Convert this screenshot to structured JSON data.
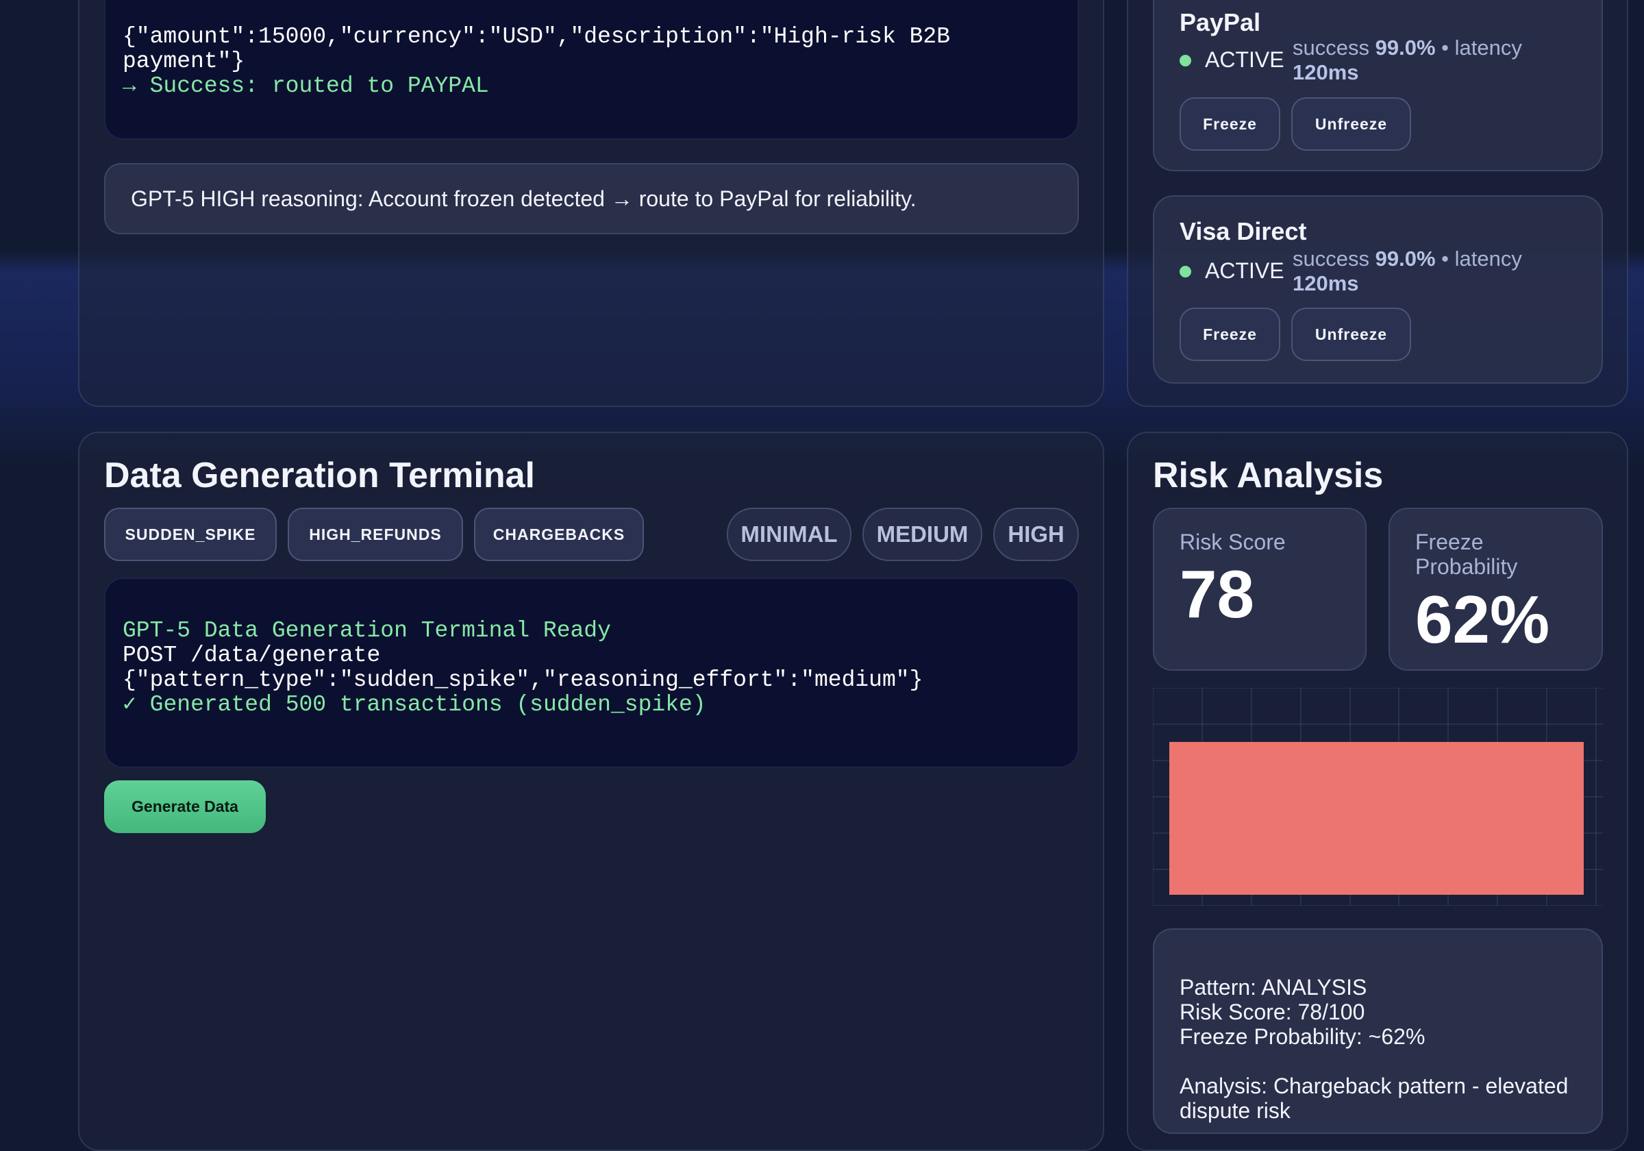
{
  "routing_terminal": {
    "line1": "{\"amount\":15000,\"currency\":\"USD\",\"description\":\"High-risk B2B",
    "line2": "payment\"}",
    "line3": "→ Success: routed to PAYPAL"
  },
  "reasoning_banner": "GPT-5 HIGH reasoning: Account frozen detected → route to PayPal for reliability.",
  "providers": [
    {
      "name": "PayPal",
      "status": "ACTIVE",
      "success_label": "success",
      "success_value": "99.0%",
      "sep": "•",
      "latency_label": "latency",
      "latency_value": "120ms",
      "freeze_label": "Freeze",
      "unfreeze_label": "Unfreeze"
    },
    {
      "name": "Visa Direct",
      "status": "ACTIVE",
      "success_label": "success",
      "success_value": "99.0%",
      "sep": "•",
      "latency_label": "latency",
      "latency_value": "120ms",
      "freeze_label": "Freeze",
      "unfreeze_label": "Unfreeze"
    }
  ],
  "data_gen": {
    "title": "Data Generation Terminal",
    "patterns": [
      "SUDDEN_SPIKE",
      "HIGH_REFUNDS",
      "CHARGEBACKS"
    ],
    "efforts": [
      "MINIMAL",
      "MEDIUM",
      "HIGH"
    ],
    "terminal": {
      "line1": "GPT-5 Data Generation Terminal Ready",
      "line2": "POST /data/generate",
      "line3": "{\"pattern_type\":\"sudden_spike\",\"reasoning_effort\":\"medium\"}",
      "line4": "✓ Generated 500 transactions (sudden_spike)"
    },
    "generate_label": "Generate Data"
  },
  "risk": {
    "title": "Risk Analysis",
    "score_label": "Risk Score",
    "score_value": "78",
    "freeze_label": "Freeze Probability",
    "freeze_value": "62%",
    "info": {
      "line1": "Pattern: ANALYSIS",
      "line2": "Risk Score: 78/100",
      "line3": "Freeze Probability: ~62%",
      "line4": "Analysis: Chargeback pattern - elevated dispute risk"
    }
  },
  "colors": {
    "accent_green": "#86e8a6",
    "bar_red": "#ed7570",
    "button_green": "#4fc386"
  },
  "chart_data": {
    "type": "bar",
    "categories": [
      ""
    ],
    "values": [
      78
    ],
    "color": "#ed7570",
    "grid": true
  }
}
